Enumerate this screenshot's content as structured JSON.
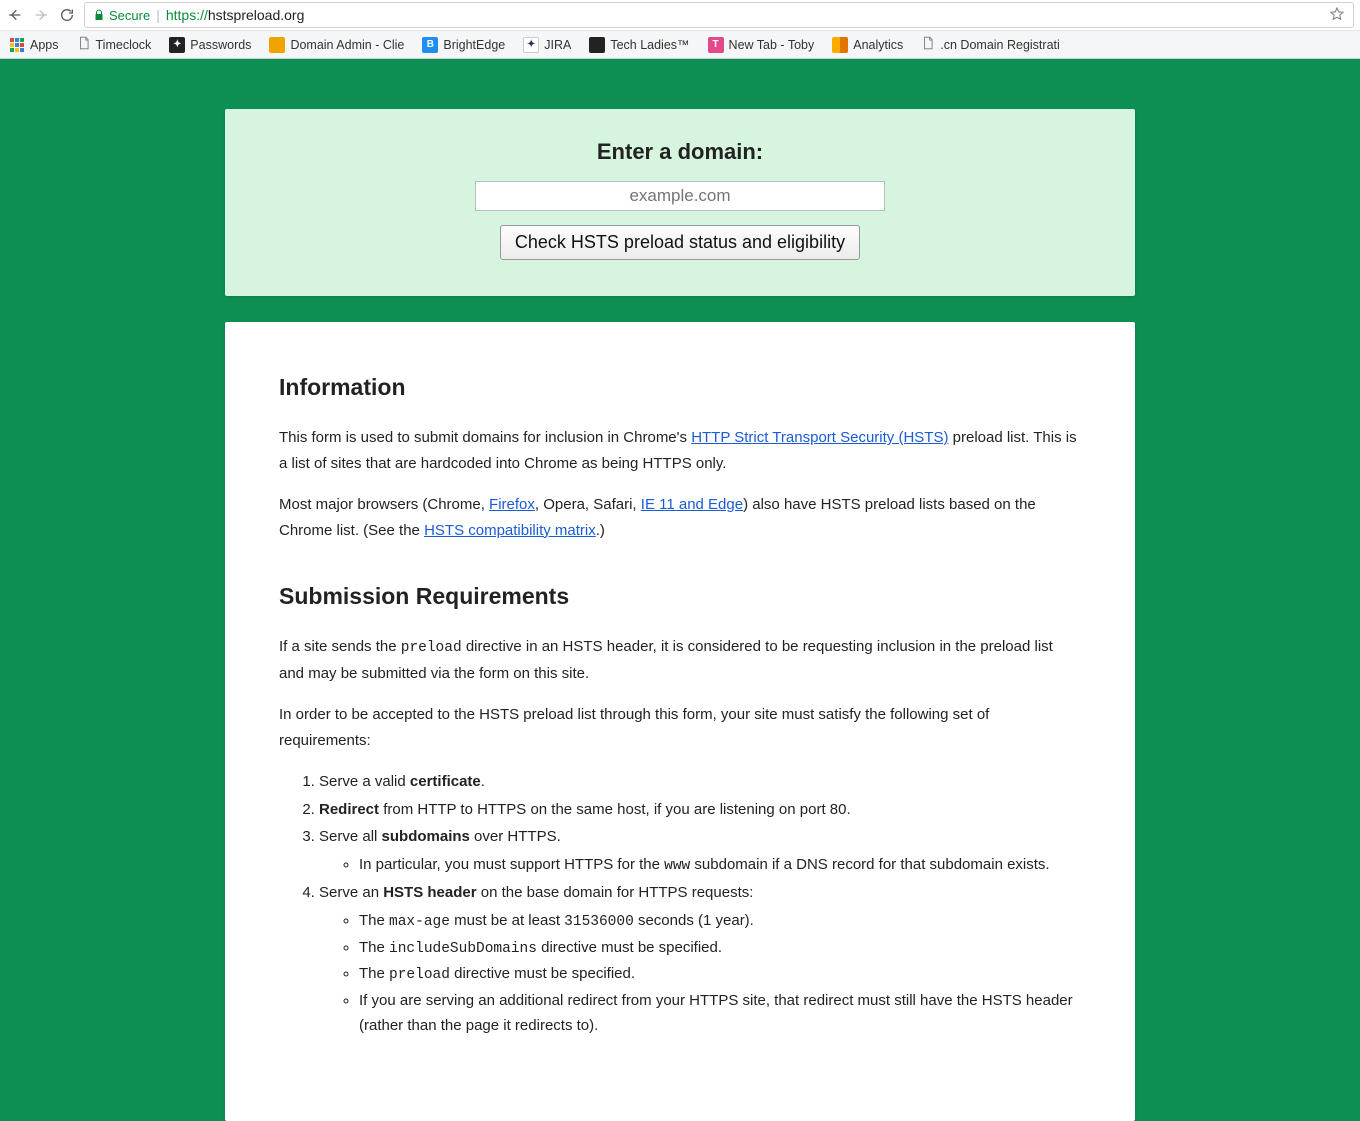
{
  "browser": {
    "url_protocol": "https://",
    "url_host": "hstspreload.org",
    "secure_label": "Secure",
    "apps_label": "Apps",
    "bookmarks": [
      {
        "label": "Timeclock",
        "icon": "file"
      },
      {
        "label": "Passwords",
        "icon": "key"
      },
      {
        "label": "Domain Admin - Clie",
        "icon": "orange"
      },
      {
        "label": "BrightEdge",
        "icon": "blue-b"
      },
      {
        "label": "JIRA",
        "icon": "jira"
      },
      {
        "label": "Tech Ladies™",
        "icon": "dark"
      },
      {
        "label": "New Tab - Toby",
        "icon": "pink"
      },
      {
        "label": "Analytics",
        "icon": "ga"
      },
      {
        "label": ".cn Domain Registrati",
        "icon": "file"
      }
    ]
  },
  "form": {
    "heading": "Enter a domain:",
    "placeholder": "example.com",
    "button": "Check HSTS preload status and eligibility"
  },
  "info": {
    "heading": "Information",
    "p1_a": "This form is used to submit domains for inclusion in Chrome's ",
    "p1_link": "HTTP Strict Transport Security (HSTS)",
    "p1_b": " preload list. This is a list of sites that are hardcoded into Chrome as being HTTPS only.",
    "p2_a": "Most major browsers (Chrome, ",
    "p2_link1": "Firefox",
    "p2_b": ", Opera, Safari, ",
    "p2_link2": "IE 11 and Edge",
    "p2_c": ") also have HSTS preload lists based on the Chrome list. (See the ",
    "p2_link3": "HSTS compatibility matrix",
    "p2_d": ".)"
  },
  "req": {
    "heading": "Submission Requirements",
    "p1_a": "If a site sends the ",
    "p1_code": "preload",
    "p1_b": " directive in an HSTS header, it is considered to be requesting inclusion in the preload list and may be submitted via the form on this site.",
    "p2": "In order to be accepted to the HSTS preload list through this form, your site must satisfy the following set of requirements:",
    "li1_a": "Serve a valid ",
    "li1_b": "certificate",
    "li1_c": ".",
    "li2_a": "Redirect",
    "li2_b": " from HTTP to HTTPS on the same host, if you are listening on port 80.",
    "li3_a": "Serve all ",
    "li3_b": "subdomains",
    "li3_c": " over HTTPS.",
    "li3_sub_a": "In particular, you must support HTTPS for the ",
    "li3_sub_code": "www",
    "li3_sub_b": " subdomain if a DNS record for that subdomain exists.",
    "li4_a": "Serve an ",
    "li4_b": "HSTS header",
    "li4_c": " on the base domain for HTTPS requests:",
    "li4_s1_a": "The ",
    "li4_s1_code1": "max-age",
    "li4_s1_b": " must be at least ",
    "li4_s1_code2": "31536000",
    "li4_s1_c": " seconds (1 year).",
    "li4_s2_a": "The ",
    "li4_s2_code": "includeSubDomains",
    "li4_s2_b": " directive must be specified.",
    "li4_s3_a": "The ",
    "li4_s3_code": "preload",
    "li4_s3_b": " directive must be specified.",
    "li4_s4": "If you are serving an additional redirect from your HTTPS site, that redirect must still have the HSTS header (rather than the page it redirects to)."
  }
}
